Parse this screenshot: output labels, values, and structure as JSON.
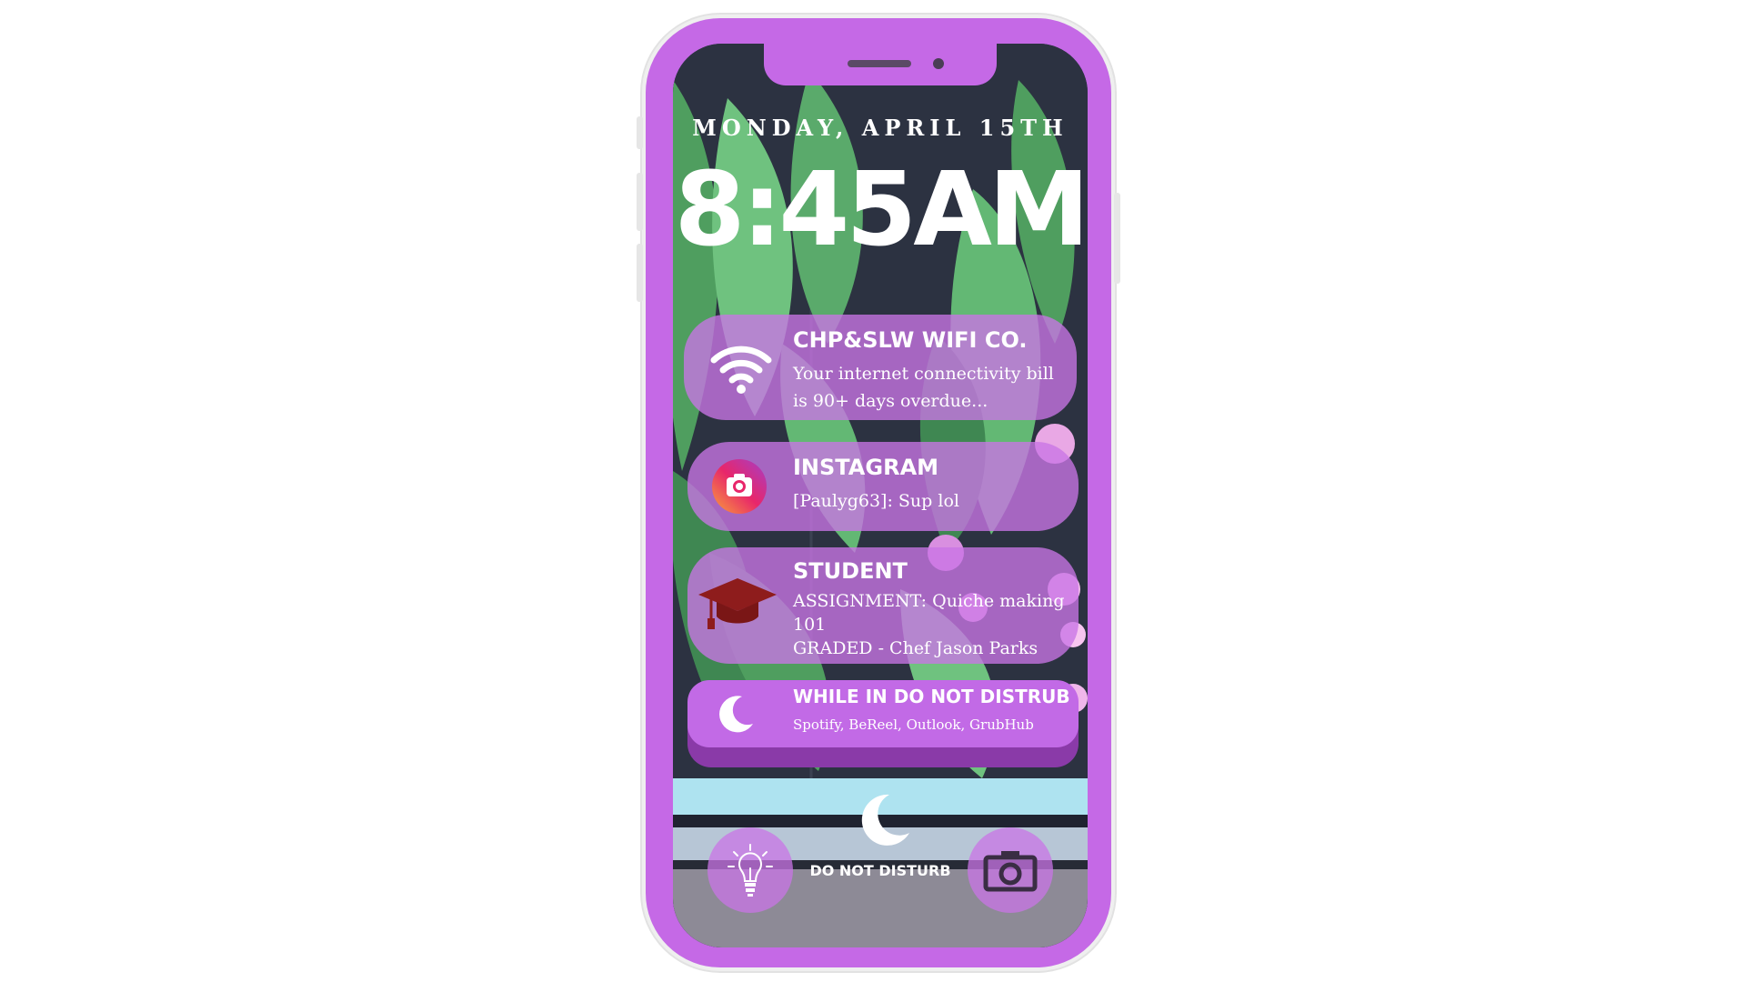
{
  "lockscreen": {
    "date": "MONDAY, APRIL 15TH",
    "time": "8:45AM"
  },
  "notifications": [
    {
      "app": "CHP&SLW WIFI CO.",
      "icon": "wifi-icon",
      "message": "Your internet connectivity bill is 90+ days overdue..."
    },
    {
      "app": "INSTAGRAM",
      "icon": "instagram-icon",
      "message": "[Paulyg63]: Sup lol"
    },
    {
      "app": "STUDENT",
      "icon": "graduation-cap-icon",
      "message_line1": "ASSIGNMENT: Quiche making 101",
      "message_line2": "GRADED - Chef Jason Parks"
    },
    {
      "app": "WHILE IN DO NOT DISTRUB",
      "icon": "moon-icon",
      "message": "Spotify, BeReel, Outlook, GrubHub"
    }
  ],
  "bottom_bar": {
    "left_icon": "flashlight-bulb-icon",
    "center_icon": "moon-icon",
    "center_label": "DO NOT DISTURB",
    "right_icon": "camera-icon"
  },
  "colors": {
    "phone_frame": "#c569e6",
    "notification_bg": "#c974e6",
    "text": "#ffffff",
    "student_cap": "#8e1c1c"
  }
}
